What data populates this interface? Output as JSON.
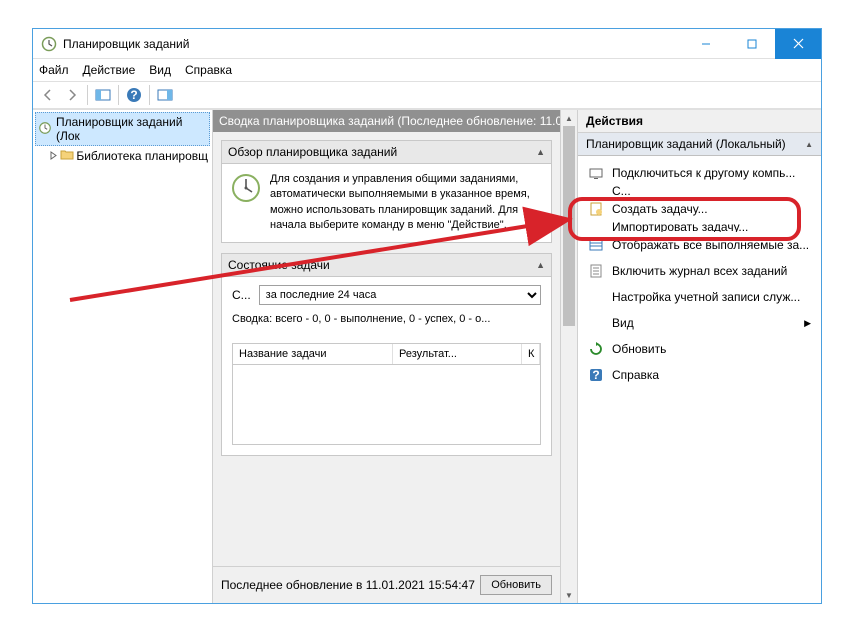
{
  "window": {
    "title": "Планировщик заданий"
  },
  "menu": {
    "file": "Файл",
    "action": "Действие",
    "view": "Вид",
    "help": "Справка"
  },
  "tree": {
    "root": "Планировщик заданий (Лок",
    "child": "Библиотека планировщ"
  },
  "mid": {
    "header": "Сводка планировщика заданий (Последнее обновление: 11.0",
    "overview_title": "Обзор планировщика заданий",
    "overview_desc": "Для создания и управления общими заданиями, автоматически выполняемыми в указанное время, можно использовать планировщик заданий. Для начала выберите команду в меню \"Действие\".",
    "status_title": "Состояние задачи",
    "status_label": "С...",
    "status_select": "за последние 24 часа",
    "status_summary": "Сводка: всего - 0, 0 - выполнение, 0 - успех, 0 - о...",
    "col_name": "Название задачи",
    "col_result": "Результат...",
    "col_extra": "К",
    "footer_text": "Последнее обновление в 11.01.2021 15:54:47",
    "footer_btn": "Обновить"
  },
  "right": {
    "header": "Действия",
    "subheader": "Планировщик заданий (Локальный)",
    "actions": [
      {
        "icon": "connect",
        "text": "Подключиться к другому компь..."
      },
      {
        "icon": "folder",
        "text": "Создать задачу..."
      },
      {
        "icon": "import",
        "text": "Импортировать задачу..."
      },
      {
        "icon": "showall",
        "text": "Отображать все выполняемые за..."
      },
      {
        "icon": "log",
        "text": "Включить журнал всех заданий"
      },
      {
        "icon": "account",
        "text": "Настройка учетной записи служ..."
      },
      {
        "icon": "view",
        "text": "Вид",
        "submenu": true
      },
      {
        "icon": "refresh",
        "text": "Обновить"
      },
      {
        "icon": "help",
        "text": "Справка"
      }
    ],
    "hidden_action": "С..."
  }
}
